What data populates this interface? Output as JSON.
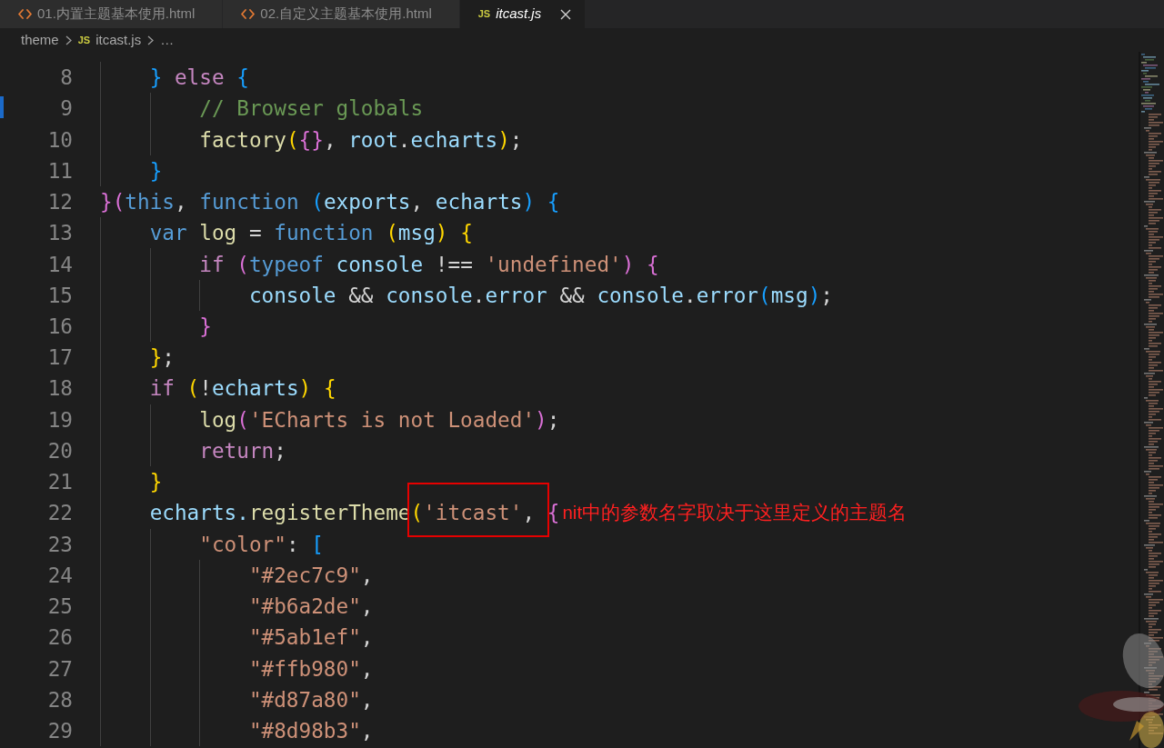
{
  "tabs": [
    {
      "kind": "html",
      "label": "01.内置主题基本使用.html",
      "selected": false,
      "preview": false
    },
    {
      "kind": "html",
      "label": "02.自定义主题基本使用.html",
      "selected": false,
      "preview": false
    },
    {
      "kind": "js",
      "type_badge": "JS",
      "label": "itcast.js",
      "selected": true,
      "preview": true
    }
  ],
  "breadcrumbs": [
    {
      "kind": "folder",
      "label": "theme"
    },
    {
      "kind": "file",
      "type_badge": "JS",
      "label": "itcast.js"
    },
    {
      "kind": "symbol",
      "label": "…"
    }
  ],
  "editor": {
    "lines": [
      {
        "number": "8",
        "tokens": [
          {
            "kind": "bracket3",
            "text": "    }"
          },
          {
            "kind": "keyword",
            "text": " else "
          },
          {
            "kind": "bracket3",
            "text": "{"
          }
        ]
      },
      {
        "number": "9",
        "tokens": [
          {
            "kind": "comment",
            "text": "        // Browser globals"
          }
        ]
      },
      {
        "number": "10",
        "tokens": [
          {
            "kind": "function",
            "text": "        factory"
          },
          {
            "kind": "bracket1",
            "text": "("
          },
          {
            "kind": "bracket2",
            "text": "{}"
          },
          {
            "kind": "plain",
            "text": ", "
          },
          {
            "kind": "variable",
            "text": "root"
          },
          {
            "kind": "plain",
            "text": "."
          },
          {
            "kind": "variable",
            "text": "echarts"
          },
          {
            "kind": "bracket1",
            "text": ")"
          },
          {
            "kind": "plain",
            "text": ";"
          }
        ]
      },
      {
        "number": "11",
        "tokens": [
          {
            "kind": "bracket3",
            "text": "    }"
          }
        ]
      },
      {
        "number": "12",
        "tokens": [
          {
            "kind": "bracket2",
            "text": "}("
          },
          {
            "kind": "storage",
            "text": "this"
          },
          {
            "kind": "plain",
            "text": ", "
          },
          {
            "kind": "storage",
            "text": "function "
          },
          {
            "kind": "bracket3",
            "text": "("
          },
          {
            "kind": "variable",
            "text": "exports"
          },
          {
            "kind": "plain",
            "text": ", "
          },
          {
            "kind": "variable",
            "text": "echarts"
          },
          {
            "kind": "bracket3",
            "text": ")"
          },
          {
            "kind": "bracket3",
            "text": " {"
          }
        ]
      },
      {
        "number": "13",
        "tokens": [
          {
            "kind": "storage",
            "text": "    var "
          },
          {
            "kind": "function",
            "text": "log"
          },
          {
            "kind": "plain",
            "text": " = "
          },
          {
            "kind": "storage",
            "text": "function "
          },
          {
            "kind": "bracket1",
            "text": "("
          },
          {
            "kind": "variable",
            "text": "msg"
          },
          {
            "kind": "bracket1",
            "text": ")"
          },
          {
            "kind": "bracket1",
            "text": " {"
          }
        ]
      },
      {
        "number": "14",
        "tokens": [
          {
            "kind": "keyword",
            "text": "        if "
          },
          {
            "kind": "bracket2",
            "text": "("
          },
          {
            "kind": "storage",
            "text": "typeof "
          },
          {
            "kind": "variable",
            "text": "console"
          },
          {
            "kind": "plain",
            "text": " !== "
          },
          {
            "kind": "string",
            "text": "'undefined'"
          },
          {
            "kind": "bracket2",
            "text": ")"
          },
          {
            "kind": "bracket2",
            "text": " {"
          }
        ]
      },
      {
        "number": "15",
        "tokens": [
          {
            "kind": "variable",
            "text": "            console"
          },
          {
            "kind": "plain",
            "text": " && "
          },
          {
            "kind": "variable",
            "text": "console"
          },
          {
            "kind": "plain",
            "text": "."
          },
          {
            "kind": "variable",
            "text": "error"
          },
          {
            "kind": "plain",
            "text": " && "
          },
          {
            "kind": "variable",
            "text": "console"
          },
          {
            "kind": "plain",
            "text": "."
          },
          {
            "kind": "variable",
            "text": "error"
          },
          {
            "kind": "bracket3",
            "text": "("
          },
          {
            "kind": "variable",
            "text": "msg"
          },
          {
            "kind": "bracket3",
            "text": ")"
          },
          {
            "kind": "plain",
            "text": ";"
          }
        ]
      },
      {
        "number": "16",
        "tokens": [
          {
            "kind": "bracket2",
            "text": "        }"
          }
        ]
      },
      {
        "number": "17",
        "tokens": [
          {
            "kind": "bracket1",
            "text": "    }"
          },
          {
            "kind": "plain",
            "text": ";"
          }
        ]
      },
      {
        "number": "18",
        "tokens": [
          {
            "kind": "keyword",
            "text": "    if "
          },
          {
            "kind": "bracket1",
            "text": "("
          },
          {
            "kind": "plain",
            "text": "!"
          },
          {
            "kind": "variable",
            "text": "echarts"
          },
          {
            "kind": "bracket1",
            "text": ")"
          },
          {
            "kind": "bracket1",
            "text": " {"
          }
        ]
      },
      {
        "number": "19",
        "tokens": [
          {
            "kind": "function",
            "text": "        log"
          },
          {
            "kind": "bracket2",
            "text": "("
          },
          {
            "kind": "string",
            "text": "'ECharts is not Loaded'"
          },
          {
            "kind": "bracket2",
            "text": ")"
          },
          {
            "kind": "plain",
            "text": ";"
          }
        ]
      },
      {
        "number": "20",
        "tokens": [
          {
            "kind": "keyword",
            "text": "        return"
          },
          {
            "kind": "plain",
            "text": ";"
          }
        ]
      },
      {
        "number": "21",
        "tokens": [
          {
            "kind": "bracket1",
            "text": "    }"
          }
        ]
      },
      {
        "number": "22",
        "tokens": [
          {
            "kind": "variable",
            "text": "    echarts."
          },
          {
            "kind": "function",
            "text": "registerTheme"
          },
          {
            "kind": "bracket1",
            "text": "(",
            "framed": true
          },
          {
            "kind": "string",
            "text": "'itcast'",
            "framed": true
          },
          {
            "kind": "plain",
            "text": ", ",
            "framed": true
          },
          {
            "kind": "bracket2",
            "text": "{"
          }
        ],
        "note": "nit中的参数名字取决于这里定义的主题名"
      },
      {
        "number": "23",
        "tokens": [
          {
            "kind": "string",
            "text": "        \"color\""
          },
          {
            "kind": "plain",
            "text": ": "
          },
          {
            "kind": "bracket3",
            "text": "["
          }
        ]
      },
      {
        "number": "24",
        "tokens": [
          {
            "kind": "string",
            "text": "            \"#2ec7c9\""
          },
          {
            "kind": "plain",
            "text": ","
          }
        ]
      },
      {
        "number": "25",
        "tokens": [
          {
            "kind": "string",
            "text": "            \"#b6a2de\""
          },
          {
            "kind": "plain",
            "text": ","
          }
        ]
      },
      {
        "number": "26",
        "tokens": [
          {
            "kind": "string",
            "text": "            \"#5ab1ef\""
          },
          {
            "kind": "plain",
            "text": ","
          }
        ]
      },
      {
        "number": "27",
        "tokens": [
          {
            "kind": "string",
            "text": "            \"#ffb980\""
          },
          {
            "kind": "plain",
            "text": ","
          }
        ]
      },
      {
        "number": "28",
        "tokens": [
          {
            "kind": "string",
            "text": "            \"#d87a80\""
          },
          {
            "kind": "plain",
            "text": ","
          }
        ]
      },
      {
        "number": "29",
        "tokens": [
          {
            "kind": "string",
            "text": "            \"#8d98b3\""
          },
          {
            "kind": "plain",
            "text": ","
          }
        ]
      }
    ]
  }
}
